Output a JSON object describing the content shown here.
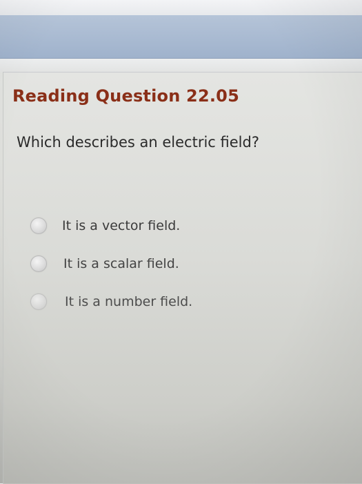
{
  "question": {
    "title": "Reading Question 22.05",
    "prompt": "Which describes an electric field?",
    "options": [
      {
        "label": "It is a vector field."
      },
      {
        "label": "It is a scalar field."
      },
      {
        "label": "It is a number field."
      }
    ]
  },
  "colors": {
    "title": "#8a2f18",
    "header_bar": "#a7b8cf",
    "text": "#2a2a2a"
  }
}
